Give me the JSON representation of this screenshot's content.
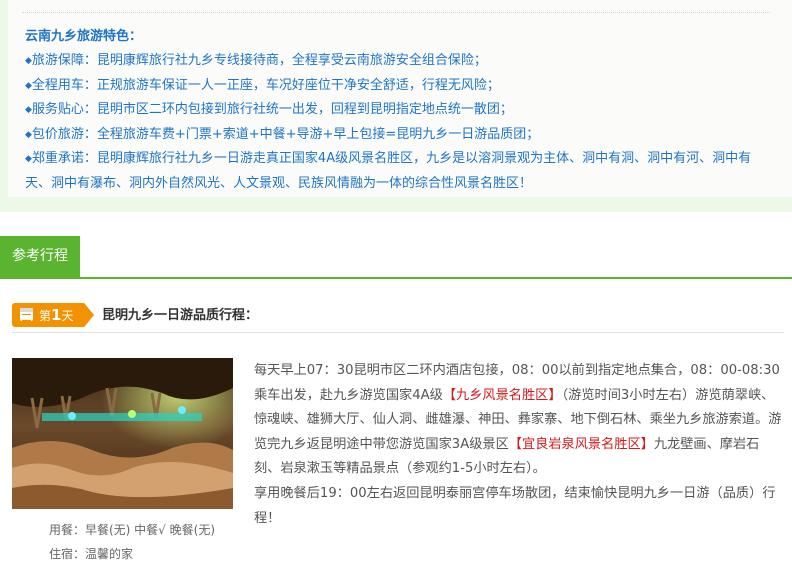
{
  "features": {
    "title": "云南九乡旅游特色：",
    "items": [
      "旅游保障：昆明康辉旅行社九乡专线接待商，全程享受云南旅游安全组合保险；",
      "全程用车：正规旅游车保证一人一正座，车况好座位干净安全舒适，行程无风险；",
      "服务贴心：昆明市区二环内包接到旅行社统一出发，回程到昆明指定地点统一散团；",
      "包价旅游：全程旅游车费+门票+索道+中餐+导游+早上包接=昆明九乡一日游品质团；",
      "郑重承诺：昆明康辉旅行社九乡一日游走真正国家4A级风景名胜区，九乡是以溶洞景观为主体、洞中有洞、洞中有河、洞中有天、洞中有瀑布、洞内外自然风光、人文景观、民族风情融为一体的综合性风景名胜区！"
    ]
  },
  "tab": {
    "label": "参考行程"
  },
  "day": {
    "prefix": "第",
    "number": "1",
    "suffix": "天",
    "title": "昆明九乡一日游品质行程："
  },
  "itinerary": {
    "part1": "每天早上07：30昆明市区二环内酒店包接，08：00以前到指定地点集合，08：00-08:30乘车出发，赴九乡游览国家4A级",
    "highlight1": "【九乡风景名胜区】",
    "part2": "（游览时间3小时左右）游览荫翠峡、惊魂峡、雄狮大厅、仙人洞、雌雄瀑、神田、彝家寨、地下倒石林、乘坐九乡旅游索道。游览完九乡返昆明途中带您游览国家3A级景区",
    "highlight2": "【宜良岩泉风景名胜区】",
    "part3": "九龙壁画、摩岩石刻、岩泉漱玉等精品景点（参观约1-5小时左右）。",
    "part4": "享用晚餐后19：00左右返回昆明泰丽宫停车场散团，结束愉快昆明九乡一日游（品质）行程！"
  },
  "meal": "用餐：早餐(无)  中餐√  晚餐(无)",
  "stay": "住宿：温馨的家",
  "colors": {
    "accent_blue": "#1f74c7",
    "tab_green": "#5ab430",
    "badge_orange": "#f39200",
    "highlight_red": "#d31a1a"
  }
}
